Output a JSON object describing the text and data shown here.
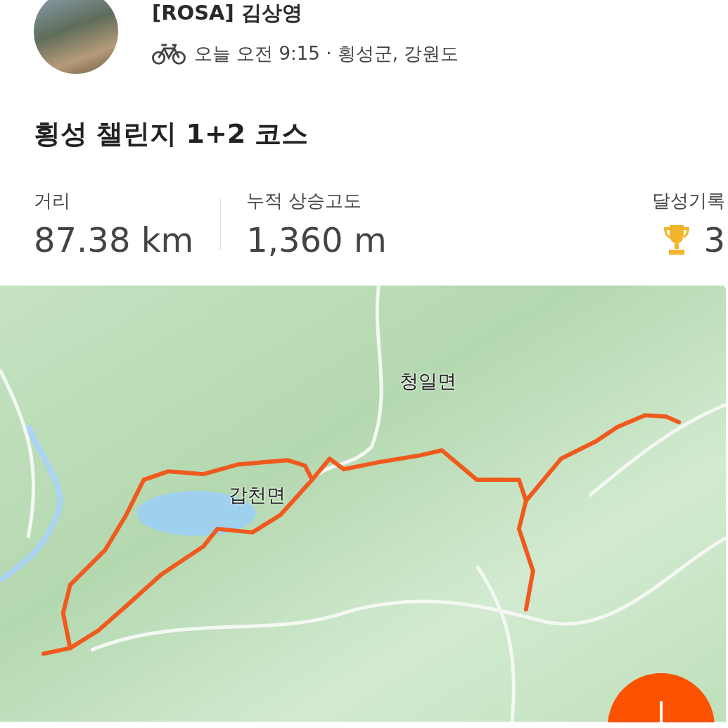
{
  "header": {
    "name": "[ROSA] 김상영",
    "meta": "오늘 오전 9:15 · 횡성군, 강원도"
  },
  "title": "횡성 챌린지 1+2 코스",
  "stats": [
    {
      "kind": "plain",
      "label": "거리",
      "value": "87.38 km"
    },
    {
      "kind": "plain",
      "label": "누적 상승고도",
      "value": "1,360 m"
    },
    {
      "kind": "trophy",
      "label": "달성기록",
      "value": "3"
    }
  ],
  "map": {
    "labels": [
      {
        "text": "청일면"
      },
      {
        "text": "갑천면"
      }
    ]
  }
}
